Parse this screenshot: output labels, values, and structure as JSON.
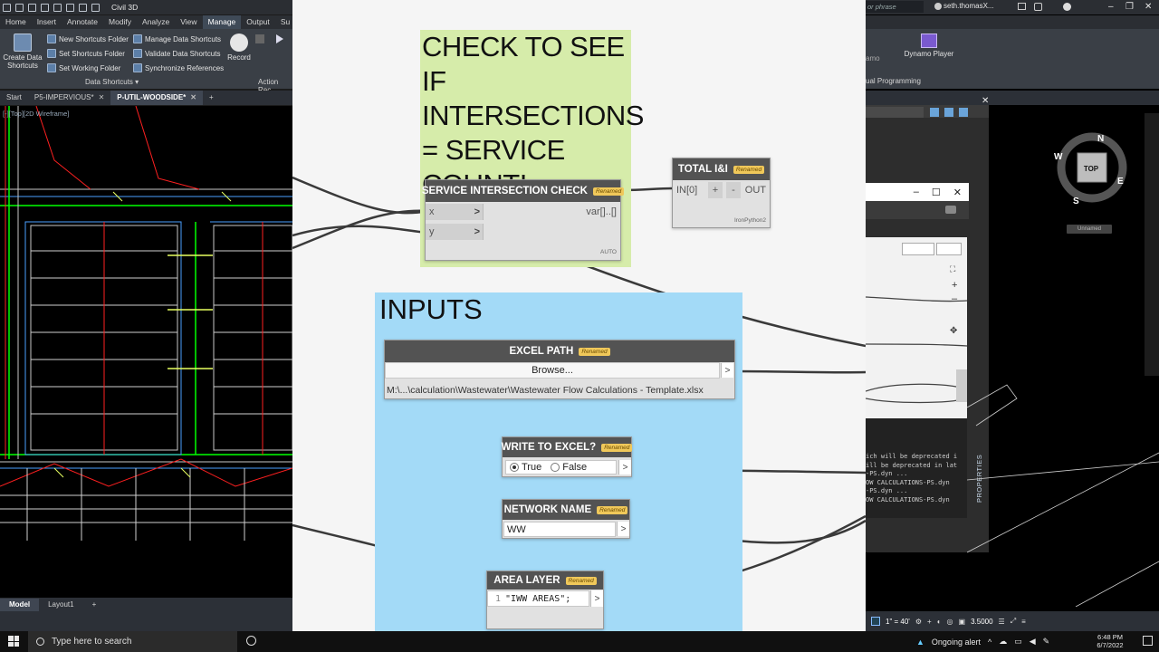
{
  "civil3d": {
    "app_title": "Civil 3D",
    "search_placeholder": "or phrase",
    "user": "seth.thomasX...",
    "menu": [
      "Home",
      "Insert",
      "Annotate",
      "Modify",
      "Analyze",
      "View",
      "Manage",
      "Output",
      "Su"
    ],
    "active_menu": "Manage",
    "ribbon": {
      "create_data_shortcuts": "Create Data\nShortcuts",
      "new_shortcuts_folder": "New Shortcuts Folder",
      "set_shortcuts_folder": "Set Shortcuts Folder",
      "set_working_folder": "Set Working Folder",
      "manage_data_shortcuts": "Manage Data Shortcuts",
      "validate_data_shortcuts": "Validate Data Shortcuts",
      "synchronize_references": "Synchronize References",
      "record": "Record",
      "panel_data_shortcuts": "Data Shortcuts ▾",
      "panel_action_rec": "Action Rec",
      "dynamo_player": "Dynamo Player",
      "partial_amo": "amo",
      "panel_visual_programming": "ual Programming"
    },
    "doc_tabs": [
      {
        "label": "Start",
        "active": false
      },
      {
        "label": "P5-IMPERVIOUS*",
        "active": false
      },
      {
        "label": "P-UTIL-WOODSIDE*",
        "active": true
      }
    ],
    "viewport_label": "[-][Top][2D Wireframe]",
    "layout_tabs": [
      "Model",
      "Layout1"
    ],
    "active_layout": "Model",
    "viewcube": {
      "top": "TOP",
      "n": "N",
      "e": "E",
      "s": "S",
      "w": "W",
      "label": "Unnamed"
    },
    "properties_label": "PROPERTIES",
    "console_lines": [
      "ich will be deprecated i",
      "ill be deprecated in lat",
      "-PS.dyn ...",
      "OW CALCULATIONS-PS.dyn",
      "-PS.dyn ...",
      "OW CALCULATIONS-PS.dyn"
    ],
    "status": {
      "scale": "1\" = 40'",
      "value": "3.5000"
    }
  },
  "dynamo": {
    "groups": {
      "check_title": "CHECK TO SEE IF INTERSECTIONS = SERVICE COUNT!",
      "inputs_title": "INPUTS"
    },
    "nodes": {
      "service_check": {
        "title": "SERVICE INTERSECTION CHECK",
        "badge": "Renamed",
        "in_x": "x",
        "in_y": "y",
        "out": "var[]..[]",
        "lacing": "AUTO"
      },
      "total_ii": {
        "title": "TOTAL I&I",
        "badge": "Renamed",
        "in0": "IN[0]",
        "plus": "+",
        "minus": "-",
        "out": "OUT",
        "engine": "IronPython2"
      },
      "excel_path": {
        "title": "EXCEL PATH",
        "badge": "Renamed",
        "browse": "Browse...",
        "path": "M:\\...\\calculation\\Wastewater\\Wastewater Flow Calculations - Template.xlsx"
      },
      "write_excel": {
        "title": "WRITE TO EXCEL?",
        "badge": "Renamed",
        "opt_true": "True",
        "opt_false": "False",
        "selected": "True"
      },
      "network_name": {
        "title": "NETWORK NAME",
        "badge": "Renamed",
        "value": "WW"
      },
      "area_layer": {
        "title": "AREA LAYER",
        "badge": "Renamed",
        "line_no": "1",
        "code": "\"IWW AREAS\";"
      }
    }
  },
  "taskbar": {
    "search_placeholder": "Type here to search",
    "alert": "Ongoing alert",
    "time": "6:48 PM",
    "date": "6/7/2022"
  }
}
